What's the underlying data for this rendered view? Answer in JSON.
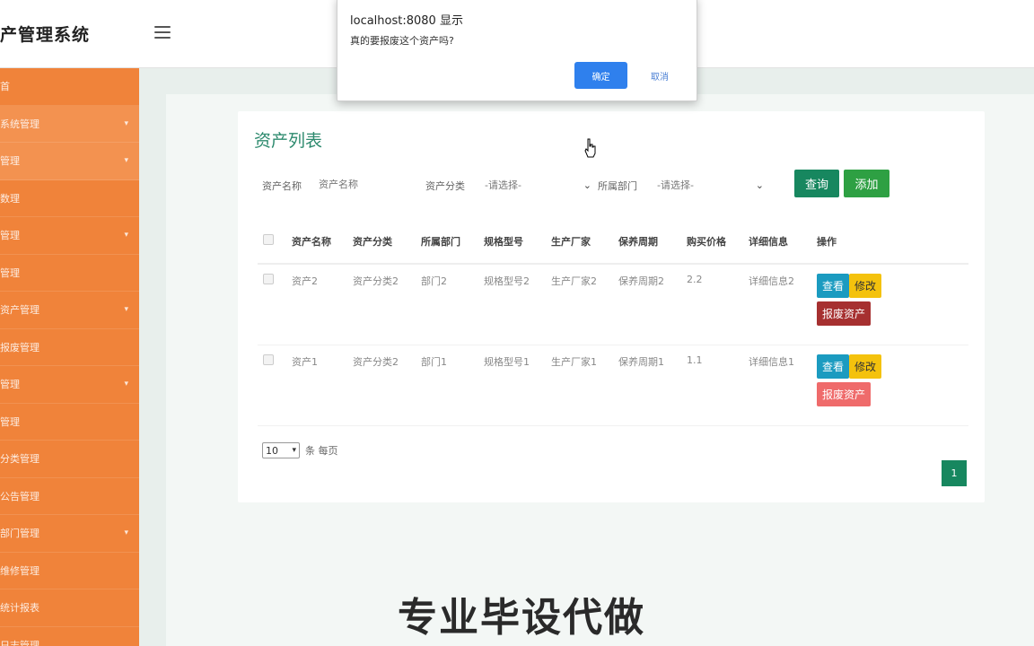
{
  "header": {
    "brand": "产管理系统"
  },
  "sidebar": {
    "items": [
      {
        "label": "首",
        "arrow": ""
      },
      {
        "label": "系统管理",
        "arrow": "▾"
      },
      {
        "label": "管理",
        "arrow": "▾"
      },
      {
        "label": "数理",
        "arrow": ""
      },
      {
        "label": "管理",
        "arrow": "▾"
      },
      {
        "label": "管理",
        "arrow": ""
      },
      {
        "label": "资产管理",
        "arrow": "▾"
      },
      {
        "label": "报废管理",
        "arrow": ""
      },
      {
        "label": "管理",
        "arrow": "▾"
      },
      {
        "label": "管理",
        "arrow": ""
      },
      {
        "label": "分类管理",
        "arrow": ""
      },
      {
        "label": "公告管理",
        "arrow": ""
      },
      {
        "label": "部门管理",
        "arrow": "▾"
      },
      {
        "label": "维修管理",
        "arrow": ""
      },
      {
        "label": "统计报表",
        "arrow": ""
      },
      {
        "label": "日志管理",
        "arrow": ""
      }
    ]
  },
  "main": {
    "title": "资产列表",
    "filters": {
      "name_label": "资产名称",
      "name_placeholder": "资产名称",
      "category_label": "资产分类",
      "category_value": "-请选择-",
      "dept_label": "所属部门",
      "dept_value": "-请选择-",
      "query_button": "查询",
      "add_button": "添加"
    },
    "table": {
      "headers": [
        "资产名称",
        "资产分类",
        "所属部门",
        "规格型号",
        "生产厂家",
        "保养周期",
        "购买价格",
        "详细信息",
        "操作"
      ],
      "rows": [
        {
          "name": "资产2",
          "category": "资产分类2",
          "dept": "部门2",
          "spec": "规格型号2",
          "maker": "生产厂家2",
          "cycle": "保养周期2",
          "price": "2.2",
          "detail": "详细信息2",
          "scrap_style": "dark"
        },
        {
          "name": "资产1",
          "category": "资产分类2",
          "dept": "部门1",
          "spec": "规格型号1",
          "maker": "生产厂家1",
          "cycle": "保养周期1",
          "price": "1.1",
          "detail": "详细信息1",
          "scrap_style": "light"
        }
      ],
      "actions": {
        "view": "查看",
        "edit": "修改",
        "scrap": "报废资产"
      }
    },
    "pagination": {
      "page_size": "10",
      "per_page_text": "条 每页",
      "current_page": "1"
    }
  },
  "watermark": "专业毕设代做",
  "dialog": {
    "title": "localhost:8080 显示",
    "message": "真的要报废这个资产吗?",
    "ok": "确定",
    "cancel": "取消"
  },
  "colors": {
    "sidebar": "#f0833a",
    "primary": "#17875f",
    "view": "#1b9bc0",
    "edit": "#f4c20d",
    "scrap_dark": "#a63030",
    "scrap_light": "#ef6b6b",
    "dialog_ok": "#2f80ed"
  }
}
